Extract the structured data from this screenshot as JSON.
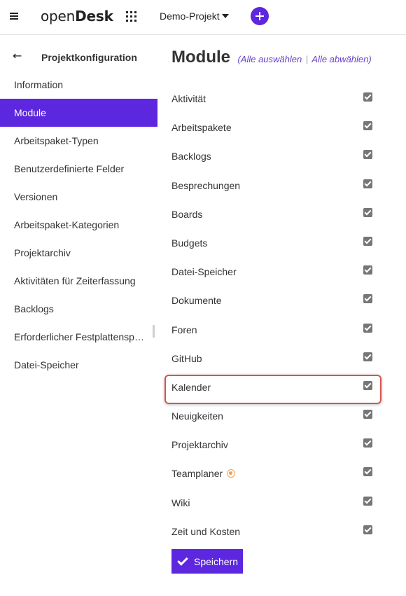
{
  "header": {
    "logo_light": "open",
    "logo_bold": "Desk",
    "project_name": "Demo-Projekt",
    "icons": [
      "hamburger-icon",
      "apps-grid-icon",
      "chevron-down-icon",
      "plus-icon"
    ],
    "accent": "#5c27de"
  },
  "sidebar": {
    "title": "Projektkonfiguration",
    "back_icon": "arrow-left-icon",
    "items": [
      {
        "label": "Information",
        "active": false
      },
      {
        "label": "Module",
        "active": true
      },
      {
        "label": "Arbeitspaket-Typen",
        "active": false
      },
      {
        "label": "Benutzerdefinierte Felder",
        "active": false
      },
      {
        "label": "Versionen",
        "active": false
      },
      {
        "label": "Arbeitspaket-Kategorien",
        "active": false
      },
      {
        "label": "Projektarchiv",
        "active": false
      },
      {
        "label": "Aktivitäten für Zeiterfassung",
        "active": false
      },
      {
        "label": "Backlogs",
        "active": false
      },
      {
        "label": "Erforderlicher Festplattenspeicher",
        "active": false
      },
      {
        "label": "Datei-Speicher",
        "active": false
      }
    ]
  },
  "main": {
    "title": "Module",
    "select_all": "(Alle auswählen",
    "separator": "|",
    "deselect_all": "Alle abwählen)",
    "modules": [
      {
        "label": "Aktivität",
        "checked": true
      },
      {
        "label": "Arbeitspakete",
        "checked": true
      },
      {
        "label": "Backlogs",
        "checked": true
      },
      {
        "label": "Besprechungen",
        "checked": true
      },
      {
        "label": "Boards",
        "checked": true
      },
      {
        "label": "Budgets",
        "checked": true
      },
      {
        "label": "Datei-Speicher",
        "checked": true
      },
      {
        "label": "Dokumente",
        "checked": true
      },
      {
        "label": "Foren",
        "checked": true
      },
      {
        "label": "GitHub",
        "checked": true
      },
      {
        "label": "Kalender",
        "checked": true,
        "highlighted": true
      },
      {
        "label": "Neuigkeiten",
        "checked": true
      },
      {
        "label": "Projektarchiv",
        "checked": true
      },
      {
        "label": "Teamplaner",
        "checked": true,
        "premium_icon": "enterprise-badge-icon"
      },
      {
        "label": "Wiki",
        "checked": true
      },
      {
        "label": "Zeit und Kosten",
        "checked": true
      }
    ],
    "save_label": "Speichern",
    "highlight_color": "#d9534f"
  }
}
